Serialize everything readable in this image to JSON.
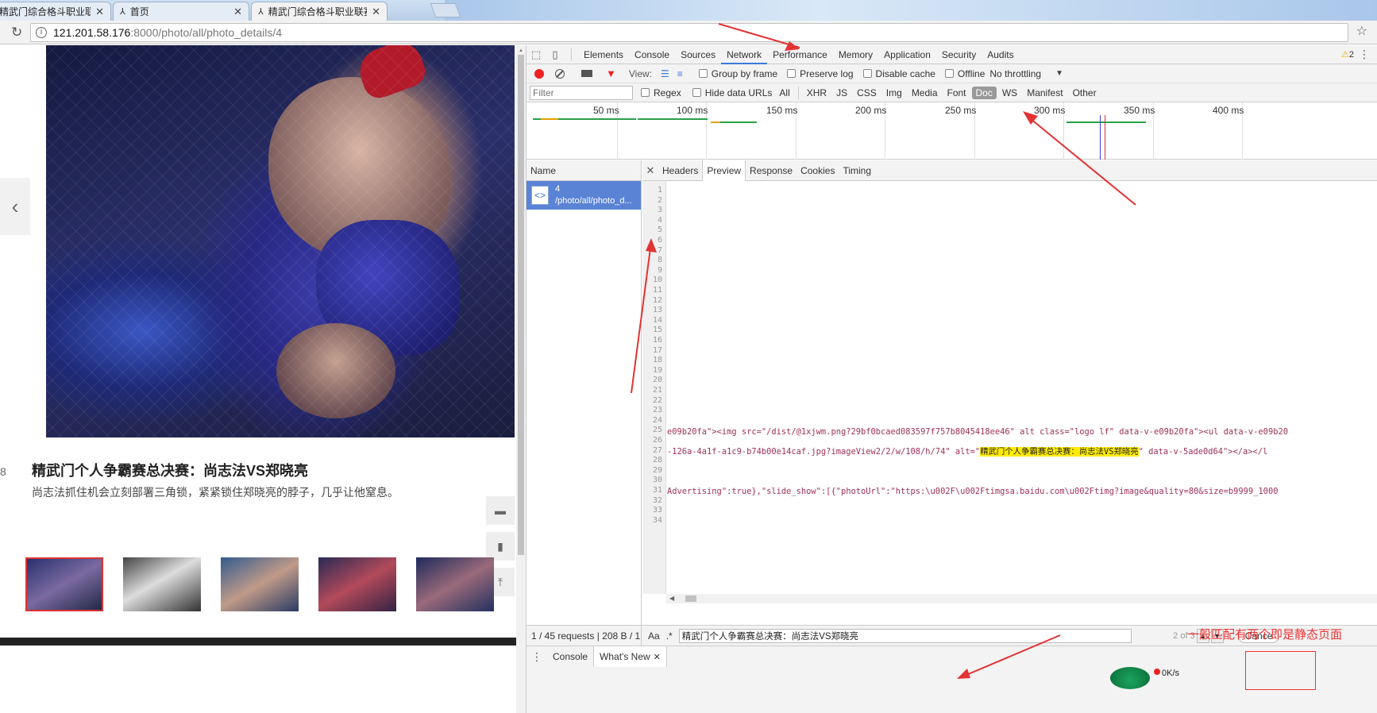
{
  "browser": {
    "tabs": [
      {
        "title": "精武门综合格斗职业联赛",
        "icon": "app-icon"
      },
      {
        "title": "首页",
        "icon": "app-icon"
      },
      {
        "title": "精武门综合格斗职业联赛",
        "icon": "app-icon",
        "active": true
      }
    ],
    "url_host": "121.201.58.176",
    "url_path": ":8000/photo/all/photo_details/4"
  },
  "page": {
    "page_number": "8",
    "title": "精武门个人争霸赛总决赛：尚志法VS郑晓亮",
    "description": "尚志法抓住机会立刻部署三角锁，紧紧锁住郑晓亮的脖子，几乎让他窒息。",
    "thumbnails": [
      "thumb-1",
      "thumb-2",
      "thumb-3",
      "thumb-4",
      "thumb-5"
    ],
    "selected_thumbnail": 1
  },
  "devtools": {
    "tabs": [
      "Elements",
      "Console",
      "Sources",
      "Network",
      "Performance",
      "Memory",
      "Application",
      "Security",
      "Audits"
    ],
    "active_tab": "Network",
    "warning_count": "2",
    "toolbar": {
      "view_label": "View:",
      "group_by_frame": "Group by frame",
      "preserve_log": "Preserve log",
      "disable_cache": "Disable cache",
      "offline": "Offline",
      "throttling": "No throttling"
    },
    "filter": {
      "placeholder": "Filter",
      "regex": "Regex",
      "hide_data_urls": "Hide data URLs",
      "types": [
        "All",
        "XHR",
        "JS",
        "CSS",
        "Img",
        "Media",
        "Font",
        "Doc",
        "WS",
        "Manifest",
        "Other"
      ],
      "active_type": "Doc"
    },
    "timeline_labels": [
      "50 ms",
      "100 ms",
      "150 ms",
      "200 ms",
      "250 ms",
      "300 ms",
      "350 ms",
      "400 ms"
    ],
    "name_header": "Name",
    "request": {
      "name": "4",
      "path": "/photo/all/photo_d..."
    },
    "detail_tabs": [
      "Headers",
      "Preview",
      "Response",
      "Cookies",
      "Timing"
    ],
    "active_detail_tab": "Preview",
    "line_numbers": [
      "1",
      "2",
      "3",
      "4",
      "5",
      "6",
      "7",
      "8",
      "9",
      "10",
      "11",
      "12",
      "13",
      "14",
      "15",
      "16",
      "17",
      "18",
      "19",
      "20",
      "21",
      "22",
      "23",
      "24",
      "25",
      "26",
      "27",
      "28",
      "29",
      "30",
      "31",
      "32",
      "33",
      "34"
    ],
    "code_lines": {
      "line25": "e09b20fa\"><img src=\"/dist/@1xjwm.png?29bf0bcaed083597f757b8045418ee46\" alt class=\"logo lf\" data-v-e09b20fa\"><ul data-v-e09b20",
      "line27_before": "-126a-4a1f-a1c9-b74b00e14caf.jpg?imageView2/2/w/108/h/74\" alt=\"",
      "line27_highlight": "精武门个人争霸赛总决赛：尚志法VS郑晓亮",
      "line27_after": "\" data-v-5ade0d64\"></a></l",
      "line31": "Advertising\":true},\"slide_show\":[{\"photoUrl\":\"https:\\u002F\\u002Ftimgsa.baidu.com\\u002Ftimg?image&quality=80&size=b9999_1000"
    },
    "status": "1 / 45 requests  |  208 B / 1...",
    "search": {
      "case_label": "Aa",
      "regex_label": ".*",
      "query": "精武门个人争霸赛总决赛：尚志法VS郑晓亮",
      "match_count": "2 of 3",
      "cancel": "Cance"
    },
    "drawer_tabs": [
      "Console",
      "What's New"
    ],
    "speed_text": "0K/s"
  },
  "annotation": {
    "note": "一般匹配有两个即是静态页面",
    "color": "#e33333"
  }
}
